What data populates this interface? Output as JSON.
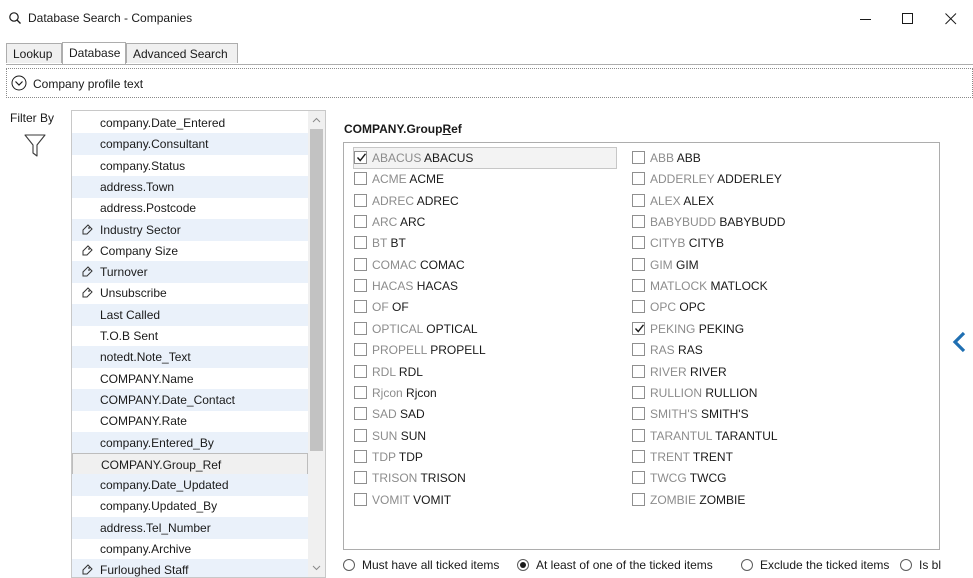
{
  "window": {
    "title": "Database Search - Companies"
  },
  "tabs": [
    {
      "label": "Lookup"
    },
    {
      "label": "Database"
    },
    {
      "label": "Advanced Search"
    }
  ],
  "active_tab": "Database",
  "profile_bar": {
    "label": "Company profile text"
  },
  "filter": {
    "label": "Filter By"
  },
  "fields": [
    {
      "label": "company.Date_Entered",
      "tagged": false
    },
    {
      "label": "company.Consultant",
      "tagged": false
    },
    {
      "label": "company.Status",
      "tagged": false
    },
    {
      "label": "address.Town",
      "tagged": false
    },
    {
      "label": "address.Postcode",
      "tagged": false
    },
    {
      "label": "Industry Sector",
      "tagged": true
    },
    {
      "label": "Company Size",
      "tagged": true
    },
    {
      "label": "Turnover",
      "tagged": true
    },
    {
      "label": "Unsubscribe",
      "tagged": true
    },
    {
      "label": "Last Called",
      "tagged": false
    },
    {
      "label": "T.O.B Sent",
      "tagged": false
    },
    {
      "label": "notedt.Note_Text",
      "tagged": false
    },
    {
      "label": "COMPANY.Name",
      "tagged": false
    },
    {
      "label": "COMPANY.Date_Contact",
      "tagged": false
    },
    {
      "label": "COMPANY.Rate",
      "tagged": false
    },
    {
      "label": "company.Entered_By",
      "tagged": false
    },
    {
      "label": "COMPANY.Group_Ref",
      "tagged": false,
      "selected": true
    },
    {
      "label": "company.Date_Updated",
      "tagged": false
    },
    {
      "label": "company.Updated_By",
      "tagged": false
    },
    {
      "label": "address.Tel_Number",
      "tagged": false
    },
    {
      "label": "company.Archive",
      "tagged": false
    },
    {
      "label": "Furloughed Staff",
      "tagged": true
    }
  ],
  "group": {
    "title_prefix": "COMPANY.Group",
    "title_underlined": "R",
    "title_suffix": "ef"
  },
  "options_left": [
    {
      "code": "ABACUS",
      "name": "ABACUS",
      "checked": true
    },
    {
      "code": "ACME",
      "name": "ACME",
      "checked": false
    },
    {
      "code": "ADREC",
      "name": "ADREC",
      "checked": false
    },
    {
      "code": "ARC",
      "name": "ARC",
      "checked": false
    },
    {
      "code": "BT",
      "name": "BT",
      "checked": false
    },
    {
      "code": "COMAC",
      "name": "COMAC",
      "checked": false
    },
    {
      "code": "HACAS",
      "name": "HACAS",
      "checked": false
    },
    {
      "code": "OF",
      "name": "OF",
      "checked": false
    },
    {
      "code": "OPTICAL",
      "name": "OPTICAL",
      "checked": false
    },
    {
      "code": "PROPELL",
      "name": "PROPELL",
      "checked": false
    },
    {
      "code": "RDL",
      "name": "RDL",
      "checked": false
    },
    {
      "code": "Rjcon",
      "name": "Rjcon",
      "checked": false
    },
    {
      "code": "SAD",
      "name": "SAD",
      "checked": false
    },
    {
      "code": "SUN",
      "name": "SUN",
      "checked": false
    },
    {
      "code": "TDP",
      "name": "TDP",
      "checked": false
    },
    {
      "code": "TRISON",
      "name": "TRISON",
      "checked": false
    },
    {
      "code": "VOMIT",
      "name": "VOMIT",
      "checked": false
    }
  ],
  "options_right": [
    {
      "code": "ABB",
      "name": "ABB",
      "checked": false
    },
    {
      "code": "ADDERLEY",
      "name": "ADDERLEY",
      "checked": false
    },
    {
      "code": "ALEX",
      "name": "ALEX",
      "checked": false
    },
    {
      "code": "BABYBUDD",
      "name": "BABYBUDD",
      "checked": false
    },
    {
      "code": "CITYB",
      "name": "CITYB",
      "checked": false
    },
    {
      "code": "GIM",
      "name": "GIM",
      "checked": false
    },
    {
      "code": "MATLOCK",
      "name": "MATLOCK",
      "checked": false
    },
    {
      "code": "OPC",
      "name": "OPC",
      "checked": false
    },
    {
      "code": "PEKING",
      "name": "PEKING",
      "checked": true
    },
    {
      "code": "RAS",
      "name": "RAS",
      "checked": false
    },
    {
      "code": "RIVER",
      "name": "RIVER",
      "checked": false
    },
    {
      "code": "RULLION",
      "name": "RULLION",
      "checked": false
    },
    {
      "code": "SMITH'S",
      "name": "SMITH'S",
      "checked": false
    },
    {
      "code": "TARANTUL",
      "name": "TARANTUL",
      "checked": false
    },
    {
      "code": "TRENT",
      "name": "TRENT",
      "checked": false
    },
    {
      "code": "TWCG",
      "name": "TWCG",
      "checked": false
    },
    {
      "code": "ZOMBIE",
      "name": "ZOMBIE",
      "checked": false
    }
  ],
  "match_options": [
    {
      "label": "Must have all ticked items",
      "selected": false
    },
    {
      "label": "At least of one of the ticked items",
      "selected": true
    },
    {
      "label": "Exclude the ticked items",
      "selected": false
    },
    {
      "label": "Is bl",
      "selected": false
    }
  ],
  "colors": {
    "accent": "#1f6fb2",
    "alt_row": "#eaf1fa"
  }
}
